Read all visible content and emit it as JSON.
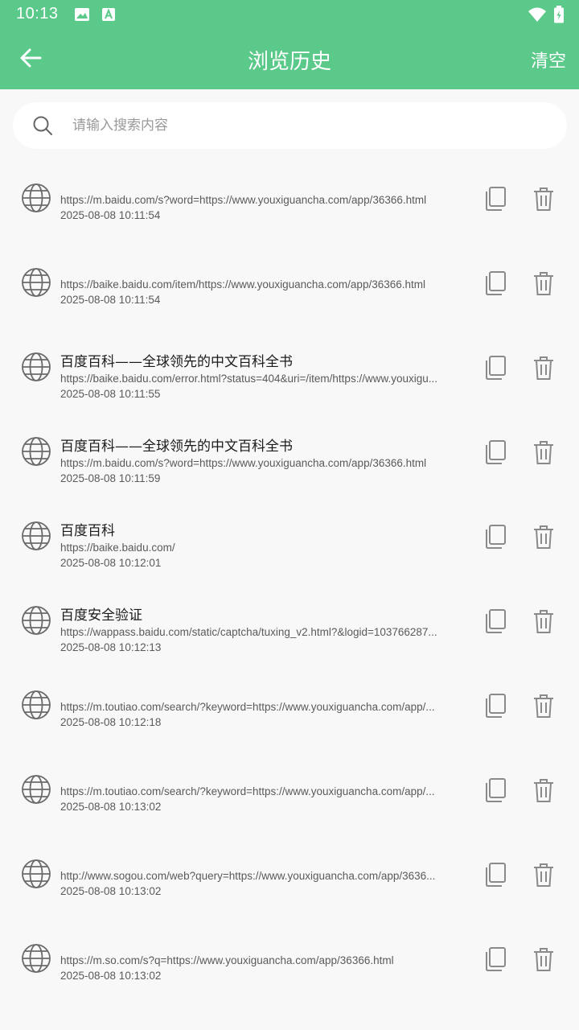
{
  "status_bar": {
    "time": "10:13",
    "left_icons": [
      "image-icon",
      "text-a-icon"
    ],
    "right_icons": [
      "wifi-icon",
      "battery-icon"
    ]
  },
  "app_bar": {
    "title": "浏览历史",
    "clear_label": "清空",
    "color": "#5bc98a"
  },
  "search": {
    "placeholder": "请输入搜索内容",
    "value": ""
  },
  "history": [
    {
      "title": "",
      "url": "https://m.baidu.com/s?word=https://www.youxiguancha.com/app/36366.html",
      "time": "2025-08-08 10:11:54"
    },
    {
      "title": "",
      "url": "https://baike.baidu.com/item/https://www.youxiguancha.com/app/36366.html",
      "time": "2025-08-08 10:11:54"
    },
    {
      "title": "百度百科——全球领先的中文百科全书",
      "url": "https://baike.baidu.com/error.html?status=404&uri=/item/https://www.youxigu...",
      "time": "2025-08-08 10:11:55"
    },
    {
      "title": "百度百科——全球领先的中文百科全书",
      "url": "https://m.baidu.com/s?word=https://www.youxiguancha.com/app/36366.html",
      "time": "2025-08-08 10:11:59"
    },
    {
      "title": "百度百科",
      "url": "https://baike.baidu.com/",
      "time": "2025-08-08 10:12:01"
    },
    {
      "title": "百度安全验证",
      "url": "https://wappass.baidu.com/static/captcha/tuxing_v2.html?&logid=103766287...",
      "time": "2025-08-08 10:12:13"
    },
    {
      "title": "",
      "url": "https://m.toutiao.com/search/?keyword=https://www.youxiguancha.com/app/...",
      "time": "2025-08-08 10:12:18"
    },
    {
      "title": "",
      "url": "https://m.toutiao.com/search/?keyword=https://www.youxiguancha.com/app/...",
      "time": "2025-08-08 10:13:02"
    },
    {
      "title": "",
      "url": "http://www.sogou.com/web?query=https://www.youxiguancha.com/app/3636...",
      "time": "2025-08-08 10:13:02"
    },
    {
      "title": "",
      "url": "https://m.so.com/s?q=https://www.youxiguancha.com/app/36366.html",
      "time": "2025-08-08 10:13:02"
    }
  ]
}
